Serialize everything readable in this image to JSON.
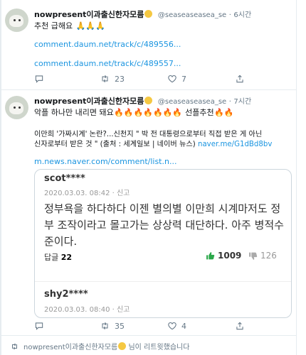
{
  "tweet1": {
    "username": "nowpresent이과출신한자모름",
    "handle": "@seaseaseasea_se",
    "dot": "·",
    "time": "6시간",
    "text": "추천 급해요",
    "links": [
      "comment.daum.net/track/c/489556...",
      "comment.daum.net/track/c/489557..."
    ],
    "retweets": "23",
    "likes": "7"
  },
  "tweet2": {
    "username": "nowpresent이과출신한자모름",
    "handle": "@seaseaseasea_se",
    "dot": "·",
    "time": "7시간",
    "text_before": "악플 하나만 내리면 돼요",
    "text_after": "선플추천",
    "quote_line1": "이만희 '가짜시계' 논란?...신천지 \" 박 전 대통령으로부터 직접 받은 게 아닌",
    "quote_line2": "신자로부터 받은 것 \" (출처 : 세계일보 | 네이버 뉴스)",
    "quote_link": "naver.me/G1dBd8bv",
    "link": "m.news.naver.com/comment/list.n...",
    "retweets": "35",
    "likes": "4"
  },
  "card": {
    "comment1": {
      "user": "scot****",
      "meta": "2020.03.03. 08:42 · 신고",
      "body": "정부욕을 하다하다 이젠 별의별 이만희 시계마저도 정부 조작이라고 몰고가는 상상력 대단하다. 아주 병적수준이다.",
      "reply_label": "답글",
      "reply_count": "22",
      "like_count": "1009",
      "dislike_count": "126"
    },
    "comment2": {
      "user": "shy2****",
      "meta": "2020.03.03. 08:40 · 신고"
    }
  },
  "retweet_note": {
    "name": "nowpresent이과출신한자모름",
    "suffix": "님이 리트윗했습니다"
  },
  "colors": {
    "link": "#1b95e0",
    "muted": "#657786",
    "like_green": "#2ba84a"
  }
}
